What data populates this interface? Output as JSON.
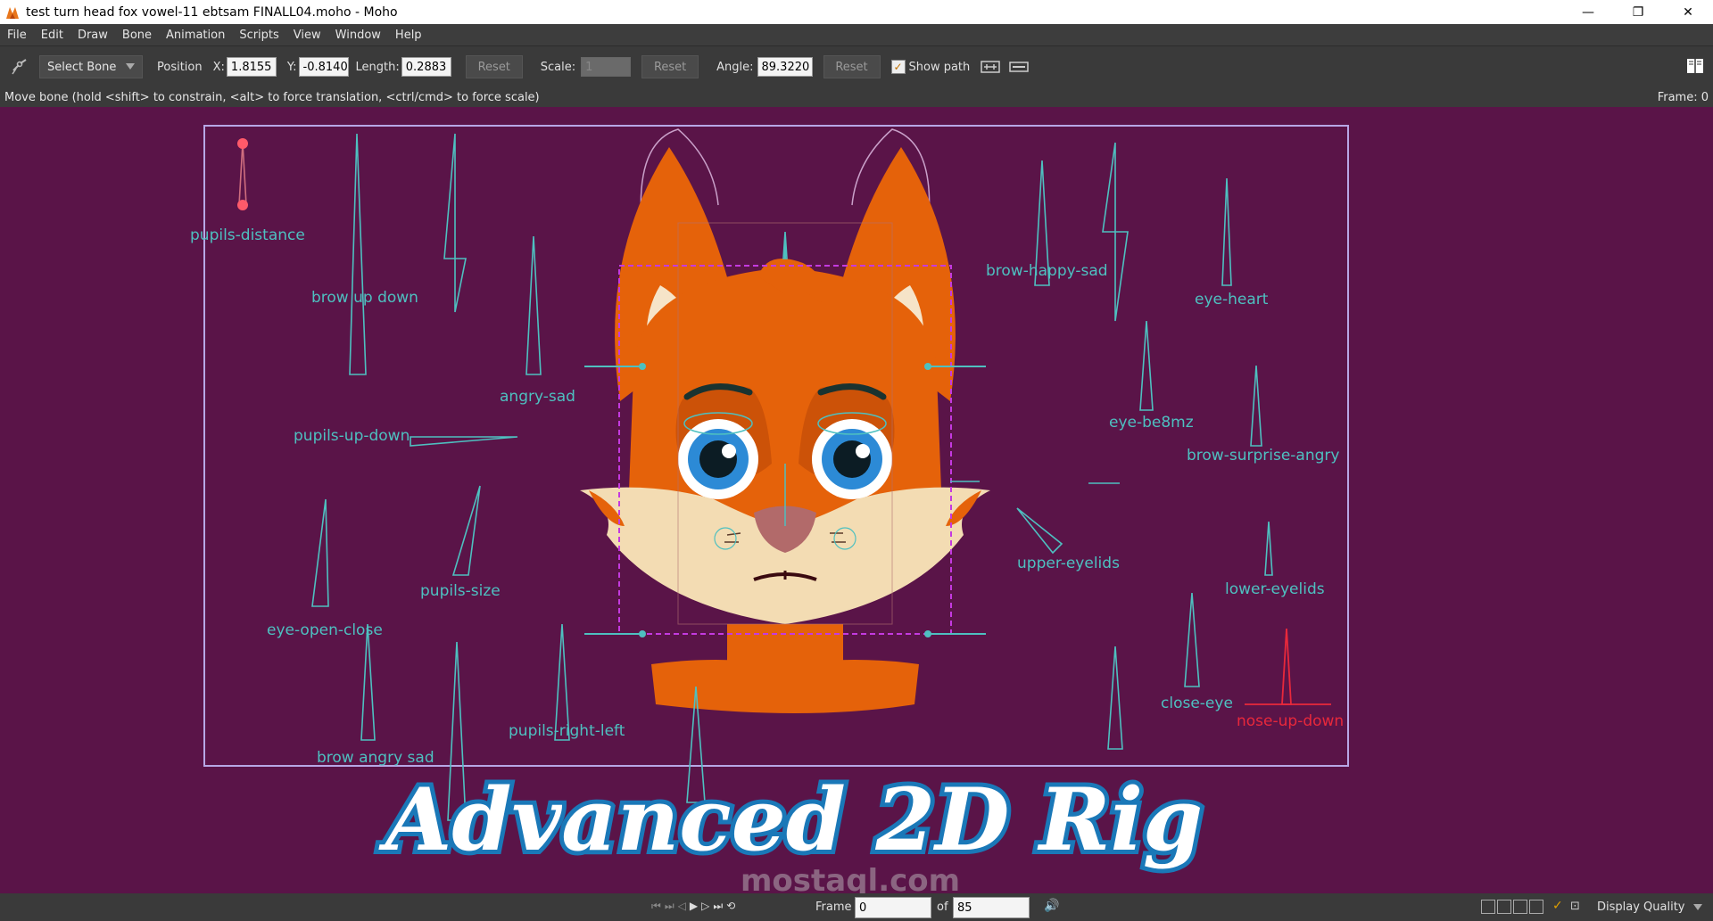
{
  "window": {
    "title": "test turn head fox vowel-11 ebtsam FINALL04.moho - Moho",
    "controls": [
      "minimize-icon",
      "restore-icon",
      "close-icon"
    ]
  },
  "menu": [
    "File",
    "Edit",
    "Draw",
    "Bone",
    "Animation",
    "Scripts",
    "View",
    "Window",
    "Help"
  ],
  "toolbar": {
    "tool_select": "Select Bone",
    "position_label": "Position",
    "x_label": "X:",
    "x_value": "1.8155",
    "y_label": "Y:",
    "y_value": "-0.8140",
    "length_label": "Length:",
    "length_value": "0.2883",
    "reset1": "Reset",
    "scale_label": "Scale:",
    "scale_value": "1",
    "reset2": "Reset",
    "angle_label": "Angle:",
    "angle_value": "89.3220",
    "reset3": "Reset",
    "show_path_label": "Show path",
    "show_path_checked": true
  },
  "status": {
    "hint": "Move bone (hold <shift> to constrain, <alt> to force translation, <ctrl/cmd> to force scale)",
    "frame": "Frame: 0"
  },
  "bones": {
    "pupils_distance": "pupils-distance",
    "brow_up_down": "brow up down",
    "angry_sad": "angry-sad",
    "pupils_up_down": "pupils-up-down",
    "eye_open_close": "eye-open-close",
    "pupils_size": "pupils-size",
    "pupils_right_left": "pupils-right-left",
    "brow_angry_sad": "brow angry sad",
    "brow_happy_sad": "brow-happy-sad",
    "eye_heart": "eye-heart",
    "eye_be8mz": "eye-be8mz",
    "brow_surprise_angry": "brow-surprise-angry",
    "upper_eyelids": "upper-eyelids",
    "lower_eyelids": "lower-eyelids",
    "close_eye": "close-eye",
    "nose_up_down": "nose-up-down"
  },
  "banner": {
    "text": "Advanced 2D Rig",
    "watermark": "mostaql.com"
  },
  "playback": {
    "frame_label": "Frame",
    "frame_value": "0",
    "of_label": "of",
    "of_value": "85",
    "display_quality": "Display Quality"
  },
  "colors": {
    "canvas_bg": "#5a1448",
    "bone": "#4ec0c0",
    "active_bone": "#e8283b",
    "fox_orange": "#e5620a",
    "fur_cream": "#f3dcb3"
  }
}
